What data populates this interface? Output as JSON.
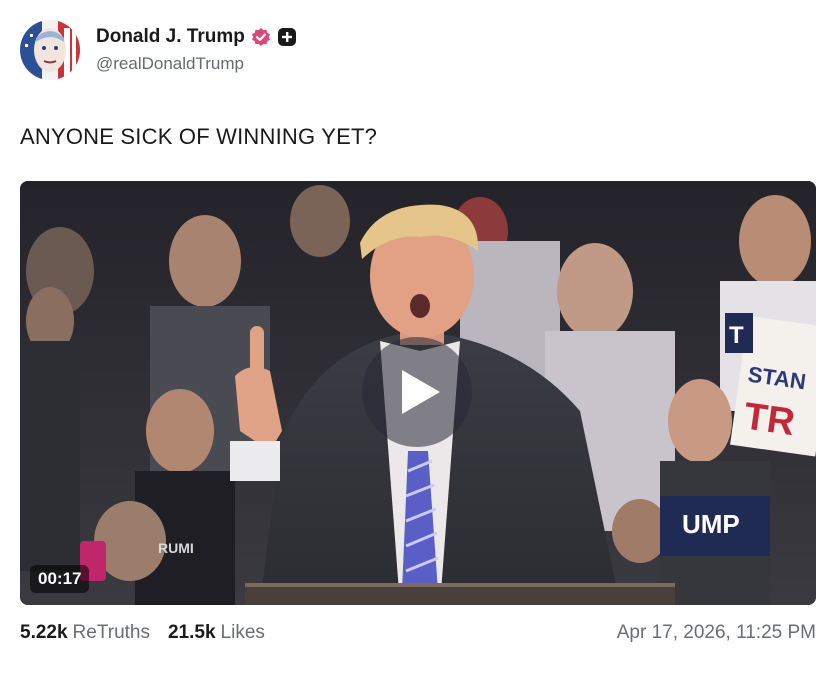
{
  "post": {
    "author": {
      "display_name": "Donald J. Trump",
      "handle": "@realDonaldTrump",
      "verified_icon": "verified-badge-icon",
      "plus_icon": "plus-badge-icon",
      "verified_color": "#e0457b"
    },
    "text": "ANYONE SICK OF WINNING YET?",
    "video": {
      "duration": "00:17",
      "sign_texts": [
        "STAN",
        "TR",
        "UMP",
        "RUMI",
        "T"
      ]
    },
    "stats": {
      "retruths_count": "5.22k",
      "retruths_label": "ReTruths",
      "likes_count": "21.5k",
      "likes_label": "Likes"
    },
    "timestamp": "Apr 17, 2026, 11:25 PM"
  }
}
